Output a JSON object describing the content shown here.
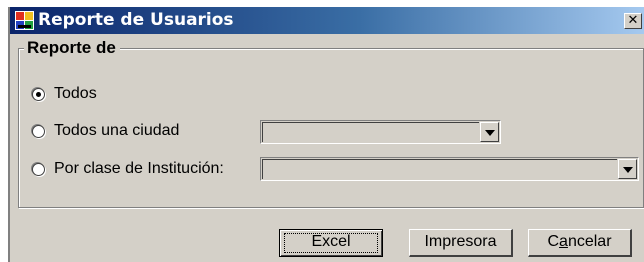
{
  "window": {
    "title": "Reporte de Usuarios",
    "close_label": "✕",
    "icon": "app-report-icon"
  },
  "group": {
    "legend": "Reporte de"
  },
  "options": [
    {
      "label": "Todos",
      "checked": true
    },
    {
      "label": "Todos una ciudad",
      "checked": false
    },
    {
      "label": "Por clase de Institución:",
      "checked": false
    }
  ],
  "combos": {
    "ciudad": {
      "value": ""
    },
    "clase_institucion": {
      "value": ""
    }
  },
  "buttons": {
    "excel": "Excel",
    "impresora": "Impresora",
    "cancelar_prefix": "C",
    "cancelar_mnemonic": "a",
    "cancelar_suffix": "ncelar"
  },
  "colors": {
    "title_gradient_start": "#0a246a",
    "title_gradient_end": "#a6caf0",
    "face": "#d4d0c8"
  }
}
